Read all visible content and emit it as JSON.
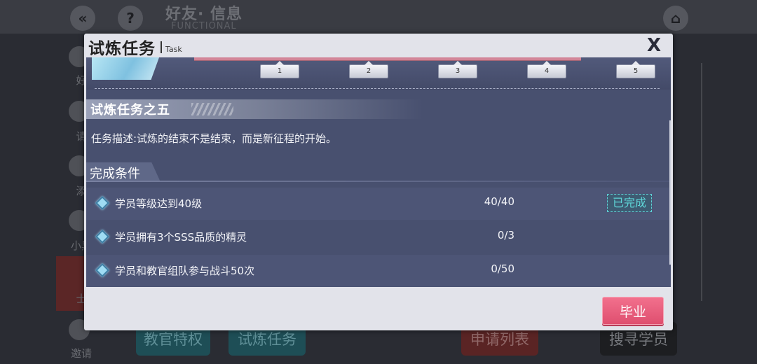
{
  "background": {
    "header_title": "好友· 信息",
    "header_subtitle": "FUNCTIONAL",
    "back_glyph": "«",
    "help_glyph": "?",
    "home_glyph": "⌂",
    "side_labels": [
      "好",
      "请",
      "添",
      "小黑",
      "士",
      "邀请"
    ],
    "bottom_buttons": [
      "教官特权",
      "试炼任务",
      "申请列表",
      "搜寻学员"
    ]
  },
  "dialog": {
    "title": "试炼任务",
    "subtitle": "Task",
    "close_label": "X",
    "milestones": [
      "1",
      "2",
      "3",
      "4",
      "5"
    ],
    "section_title": "试炼任务之五",
    "description": "任务描述:试炼的结束不是结束，而是新征程的开始。",
    "conditions_title": "完成条件",
    "conditions": [
      {
        "text": "学员等级达到40级",
        "progress": "40/40",
        "status": "已完成"
      },
      {
        "text": "学员拥有3个SSS品质的精灵",
        "progress": "0/3"
      },
      {
        "text": "学员和教官组队参与战斗50次",
        "progress": "0/50"
      }
    ],
    "graduate_label": "毕业"
  },
  "colors": {
    "accent_pink": "#e85a7a",
    "done_cyan": "#5fd6d8",
    "panel_navy": "#48506f"
  }
}
